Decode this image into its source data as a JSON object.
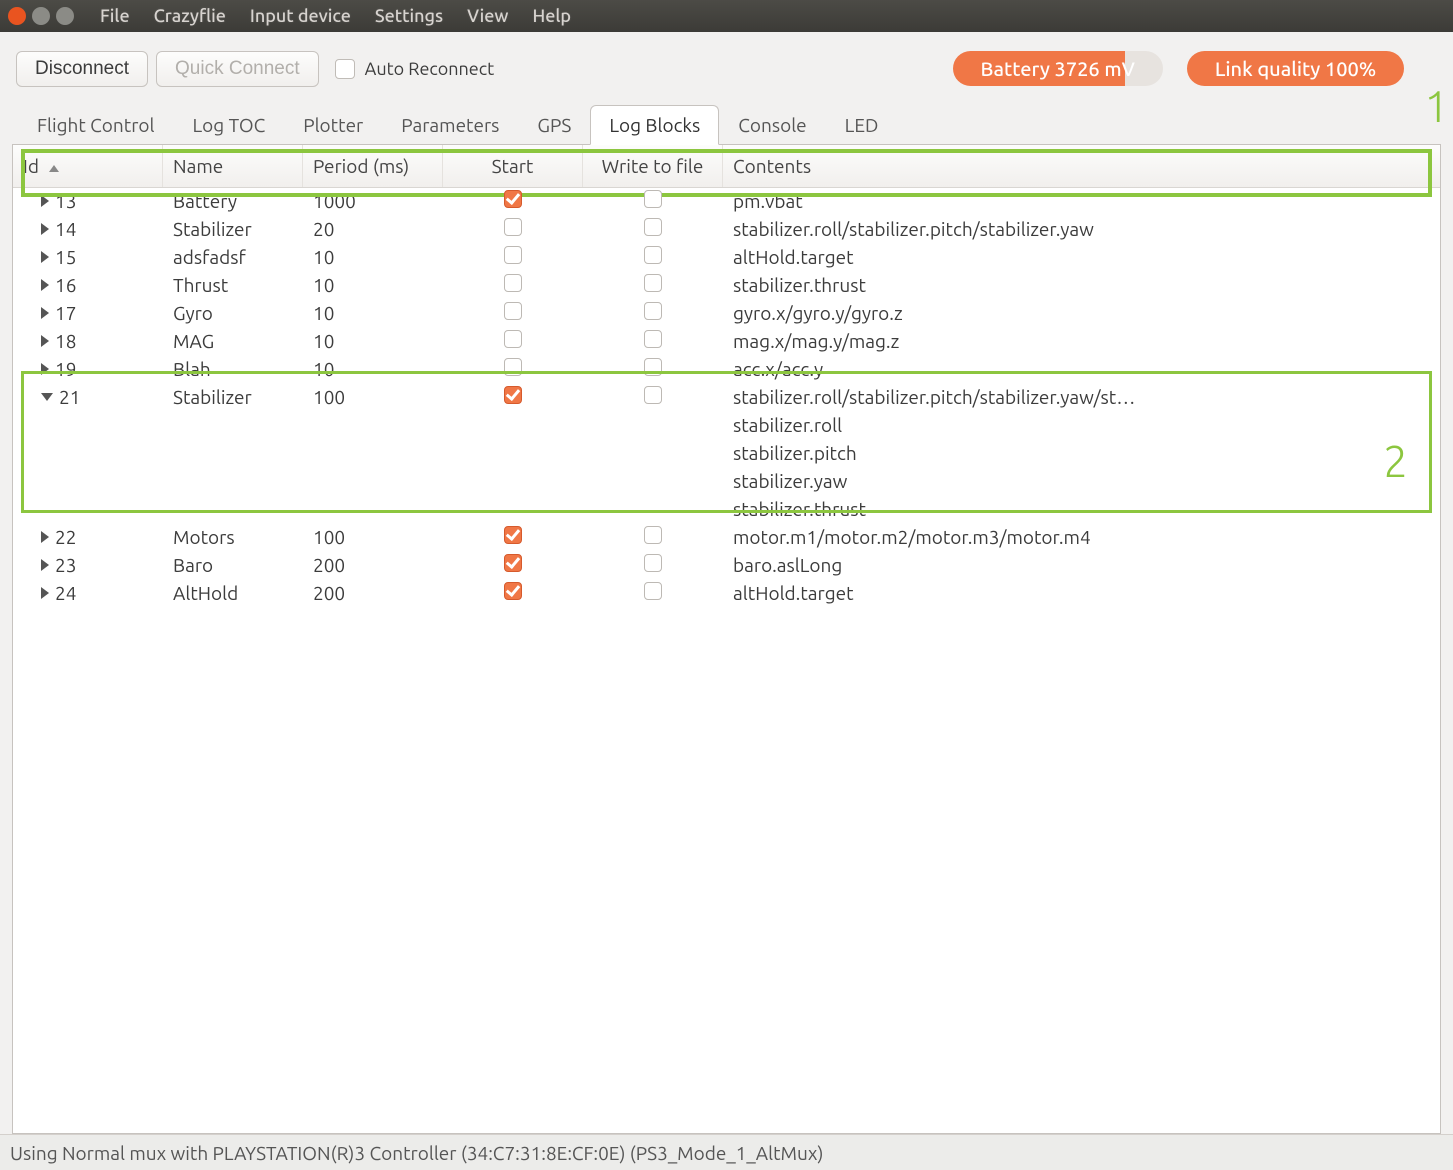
{
  "window": {
    "close": "",
    "min": "",
    "max": ""
  },
  "menu": [
    "File",
    "Crazyflie",
    "Input device",
    "Settings",
    "View",
    "Help"
  ],
  "toolbar": {
    "disconnect": "Disconnect",
    "quickconnect": "Quick Connect",
    "auto_reconnect_label": "Auto Reconnect",
    "auto_reconnect_checked": false,
    "battery_label": "Battery 3726 mV",
    "link_label": "Link quality 100%"
  },
  "tabs": [
    "Flight Control",
    "Log TOC",
    "Plotter",
    "Parameters",
    "GPS",
    "Log Blocks",
    "Console",
    "LED"
  ],
  "active_tab": "Log Blocks",
  "columns": {
    "id": "Id",
    "name": "Name",
    "period": "Period (ms)",
    "start": "Start",
    "write": "Write to file",
    "contents": "Contents",
    "sorted": "id"
  },
  "rows": [
    {
      "expanded": false,
      "id": "13",
      "name": "Battery",
      "period": "1000",
      "start": true,
      "write": false,
      "contents": "pm.vbat"
    },
    {
      "expanded": false,
      "id": "14",
      "name": "Stabilizer",
      "period": "20",
      "start": false,
      "write": false,
      "contents": "stabilizer.roll/stabilizer.pitch/stabilizer.yaw"
    },
    {
      "expanded": false,
      "id": "15",
      "name": "adsfadsf",
      "period": "10",
      "start": false,
      "write": false,
      "contents": "altHold.target"
    },
    {
      "expanded": false,
      "id": "16",
      "name": "Thrust",
      "period": "10",
      "start": false,
      "write": false,
      "contents": "stabilizer.thrust"
    },
    {
      "expanded": false,
      "id": "17",
      "name": "Gyro",
      "period": "10",
      "start": false,
      "write": false,
      "contents": "gyro.x/gyro.y/gyro.z"
    },
    {
      "expanded": false,
      "id": "18",
      "name": "MAG",
      "period": "10",
      "start": false,
      "write": false,
      "contents": "mag.x/mag.y/mag.z"
    },
    {
      "expanded": false,
      "id": "19",
      "name": "Blah",
      "period": "10",
      "start": false,
      "write": false,
      "contents": "acc.x/acc.y"
    },
    {
      "expanded": true,
      "id": "21",
      "name": "Stabilizer",
      "period": "100",
      "start": true,
      "write": false,
      "contents": "stabilizer.roll/stabilizer.pitch/stabilizer.yaw/st…",
      "children": [
        "stabilizer.roll",
        "stabilizer.pitch",
        "stabilizer.yaw",
        "stabilizer.thrust"
      ]
    },
    {
      "expanded": false,
      "id": "22",
      "name": "Motors",
      "period": "100",
      "start": true,
      "write": false,
      "contents": "motor.m1/motor.m2/motor.m3/motor.m4"
    },
    {
      "expanded": false,
      "id": "23",
      "name": "Baro",
      "period": "200",
      "start": true,
      "write": false,
      "contents": "baro.aslLong"
    },
    {
      "expanded": false,
      "id": "24",
      "name": "AltHold",
      "period": "200",
      "start": true,
      "write": false,
      "contents": "altHold.target"
    }
  ],
  "annotations": {
    "label1": "1",
    "label2": "2"
  },
  "status": "Using Normal mux with PLAYSTATION(R)3 Controller (34:C7:31:8E:CF:0E) (PS3_Mode_1_AltMux)"
}
